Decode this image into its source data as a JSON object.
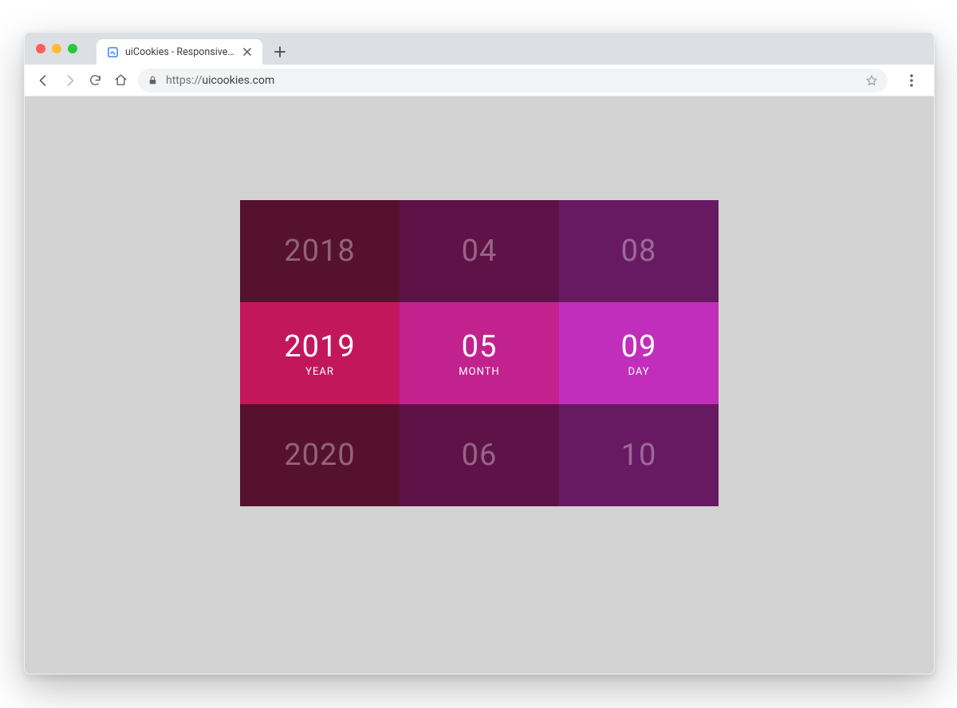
{
  "browser": {
    "tab_title": "uiCookies - Responsive HTML",
    "url_scheme": "https://",
    "url_host_path": "uicookies.com"
  },
  "picker": {
    "year": {
      "prev": "2018",
      "curr": "2019",
      "next": "2020",
      "label": "YEAR"
    },
    "month": {
      "prev": "04",
      "curr": "05",
      "next": "06",
      "label": "MONTH"
    },
    "day": {
      "prev": "08",
      "curr": "09",
      "next": "10",
      "label": "DAY"
    }
  }
}
